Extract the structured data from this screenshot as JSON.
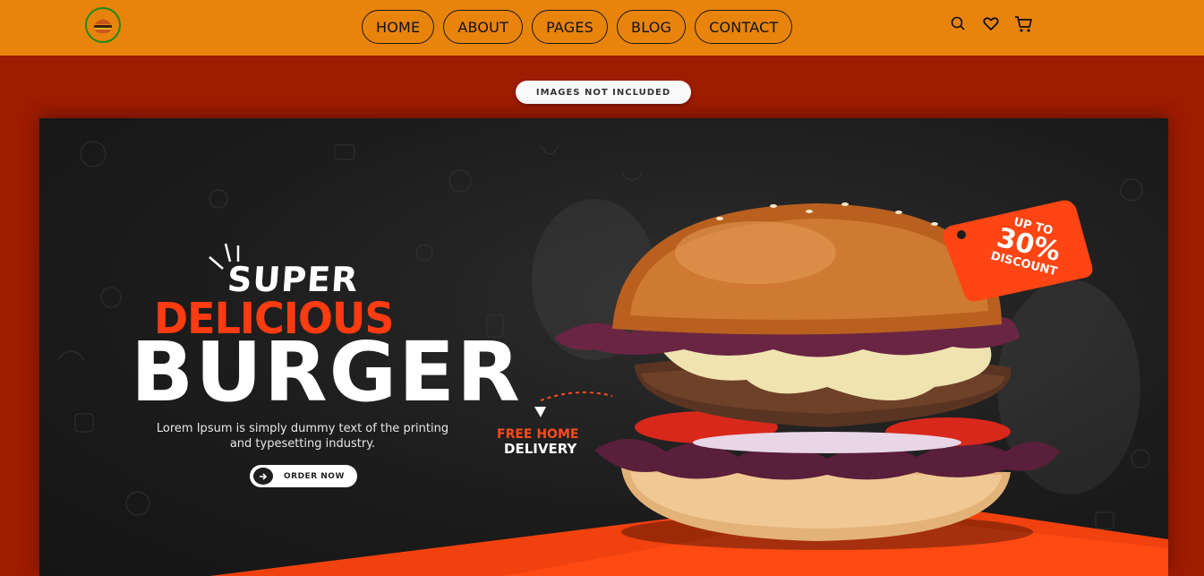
{
  "header": {
    "logo_icon": "burger-logo-icon",
    "nav": [
      "HOME",
      "ABOUT",
      "PAGES",
      "BLOG",
      "CONTACT"
    ],
    "icons": [
      "search-icon",
      "heart-icon",
      "cart-icon"
    ]
  },
  "notice": "IMAGES NOT INCLUDED",
  "hero": {
    "line1": "SUPER",
    "line2": "DELICIOUS",
    "line3": "BURGER",
    "description": "Lorem Ipsum is simply dummy text of the printing and typesetting industry.",
    "cta": "ORDER NOW",
    "free_line1": "FREE HOME",
    "free_line2": "DELIVERY",
    "discount_top": "UP TO",
    "discount_value": "30%",
    "discount_bottom": "DISCOUNT"
  },
  "colors": {
    "header_bg": "#e8830c",
    "page_bg": "#9e1c00",
    "accent": "#ff3b12",
    "hero_bg": "#1c1c1c"
  }
}
